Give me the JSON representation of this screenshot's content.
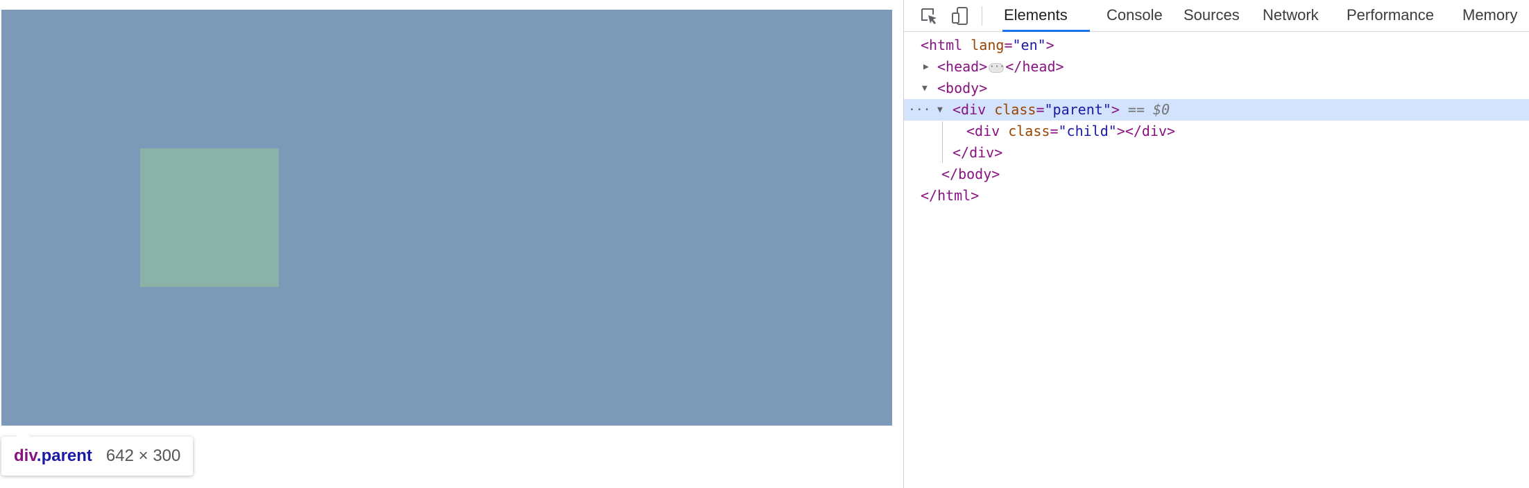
{
  "viewport": {
    "tooltip": {
      "tag": "div",
      "class_name": ".parent",
      "dimensions": "642 × 300"
    },
    "colors": {
      "parent": "#7d99b8",
      "child": "#8ab2a8"
    }
  },
  "devtools": {
    "tabs": [
      {
        "label": "Elements",
        "active": true
      },
      {
        "label": "Console"
      },
      {
        "label": "Sources"
      },
      {
        "label": "Network"
      },
      {
        "label": "Performance"
      },
      {
        "label": "Memory"
      }
    ],
    "icons": [
      "inspect-element-icon",
      "device-toolbar-icon"
    ],
    "dom": {
      "html_open": "<html",
      "lang_attr": "lang",
      "lang_value": "\"en\"",
      "head_open": "<head>",
      "head_close": "</head>",
      "body_open": "<body>",
      "parent_open": "<div",
      "class_attr": "class",
      "parent_class": "\"parent\"",
      "selected_marker": "== $0",
      "child_open": "<div",
      "child_class": "\"child\"",
      "div_close": "</div>",
      "body_close": "</body>",
      "html_close": "</html>"
    }
  }
}
